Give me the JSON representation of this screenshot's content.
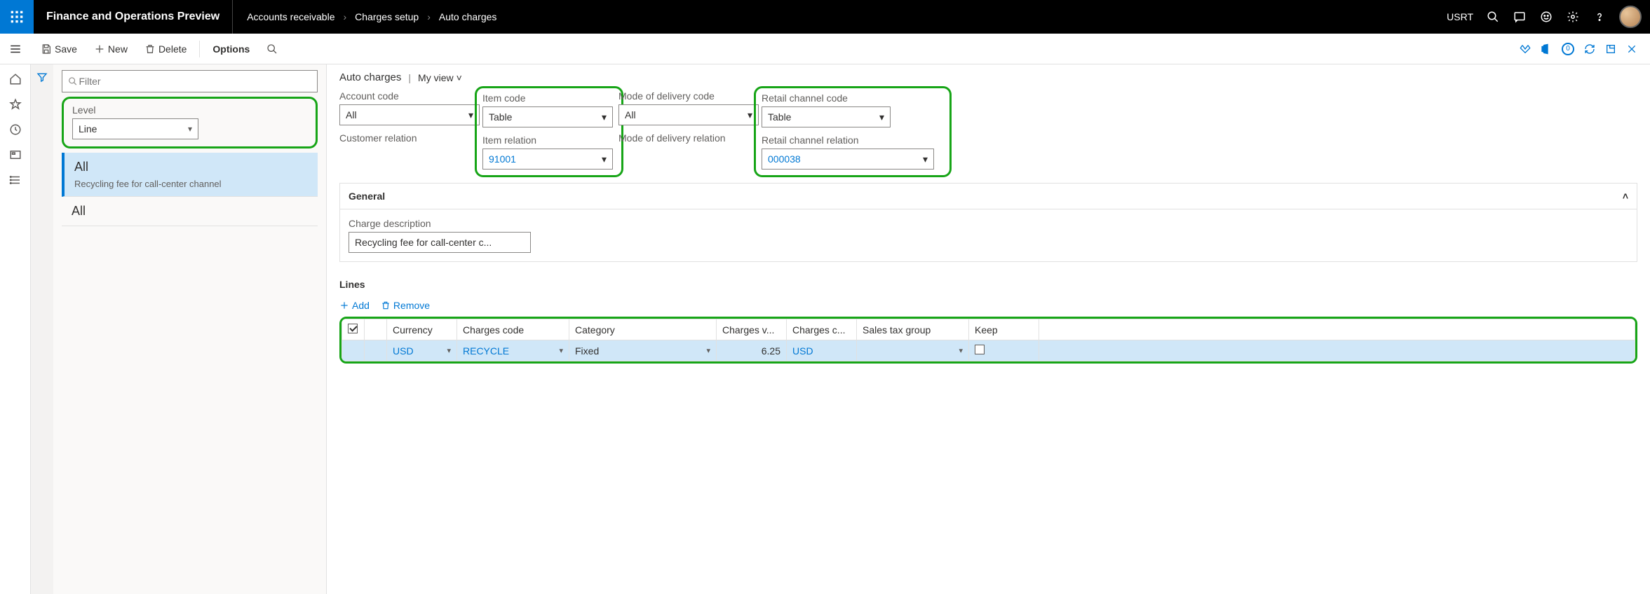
{
  "topbar": {
    "app_title": "Finance and Operations Preview",
    "breadcrumb": [
      "Accounts receivable",
      "Charges setup",
      "Auto charges"
    ],
    "company": "USRT"
  },
  "actionbar": {
    "save": "Save",
    "new": "New",
    "delete": "Delete",
    "options": "Options",
    "attachments_count": "0"
  },
  "leftpane": {
    "filter_placeholder": "Filter",
    "level_label": "Level",
    "level_value": "Line",
    "items": [
      {
        "title": "All",
        "sub": "Recycling fee for call-center channel"
      },
      {
        "title": "All",
        "sub": ""
      }
    ]
  },
  "page": {
    "title": "Auto charges",
    "view": "My view",
    "fields": {
      "account_code": {
        "label": "Account code",
        "value": "All"
      },
      "item_code": {
        "label": "Item code",
        "value": "Table"
      },
      "delivery_code": {
        "label": "Mode of delivery code",
        "value": "All"
      },
      "channel_code": {
        "label": "Retail channel code",
        "value": "Table"
      },
      "customer_relation": {
        "label": "Customer relation",
        "value": ""
      },
      "item_relation": {
        "label": "Item relation",
        "value": "91001"
      },
      "delivery_relation": {
        "label": "Mode of delivery relation",
        "value": ""
      },
      "channel_relation": {
        "label": "Retail channel relation",
        "value": "000038"
      }
    },
    "general": {
      "header": "General",
      "desc_label": "Charge description",
      "desc_value": "Recycling fee for call-center c..."
    },
    "lines": {
      "header": "Lines",
      "add": "Add",
      "remove": "Remove",
      "columns": [
        "Currency",
        "Charges code",
        "Category",
        "Charges v...",
        "Charges c...",
        "Sales tax group",
        "Keep"
      ],
      "rows": [
        {
          "currency": "USD",
          "code": "RECYCLE",
          "category": "Fixed",
          "value": "6.25",
          "charges_c": "USD",
          "tax": "",
          "keep": false
        }
      ]
    }
  }
}
